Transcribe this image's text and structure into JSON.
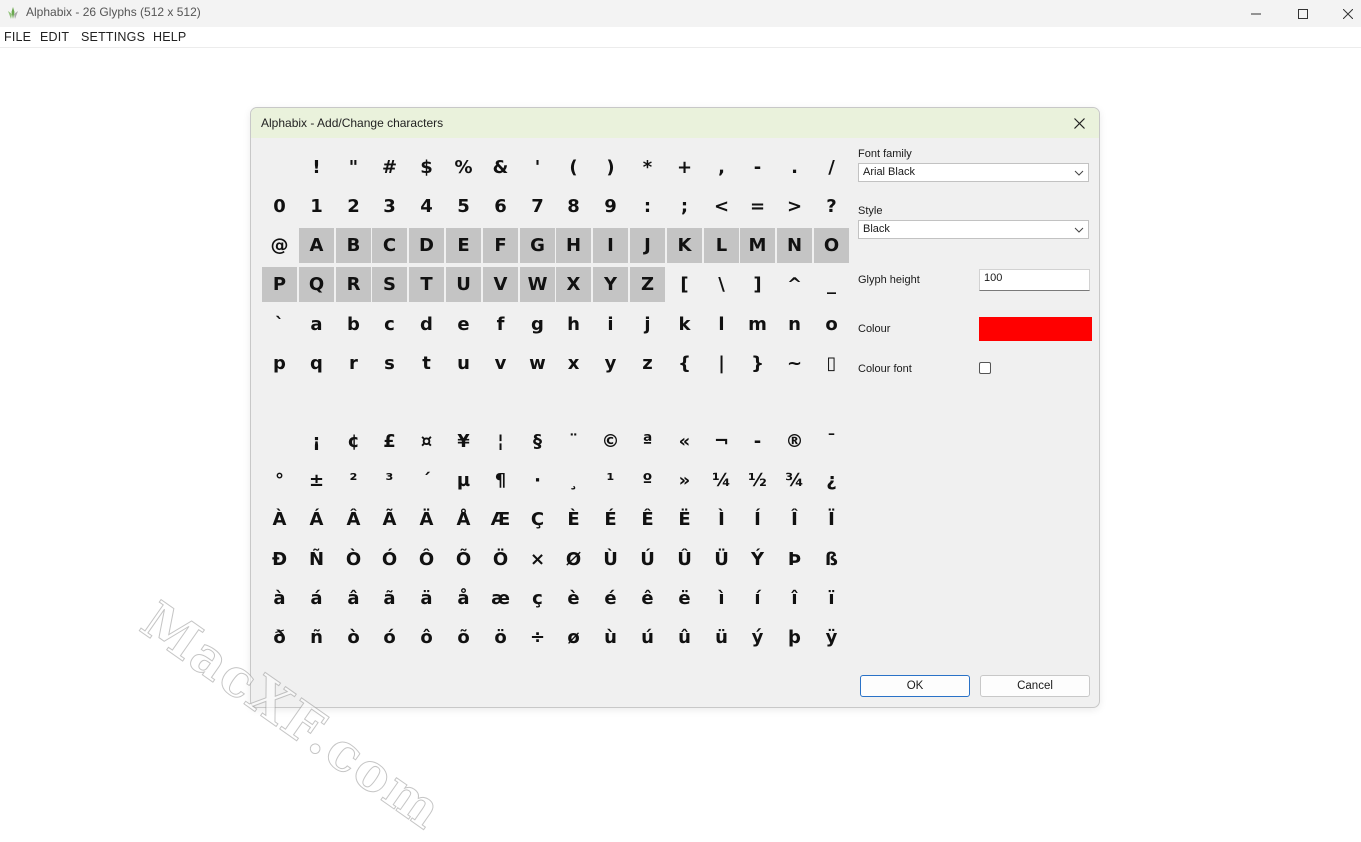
{
  "window": {
    "title": "Alphabix - 26 Glyphs (512 x 512)",
    "controls": [
      "minimize-icon",
      "maximize-icon",
      "close-icon"
    ]
  },
  "menu": [
    "FILE",
    "EDIT",
    "SETTINGS",
    "HELP"
  ],
  "dialog": {
    "title": "Alphabix - Add/Change characters",
    "glyph_rows": [
      [
        " ",
        "!",
        "\"",
        "#",
        "$",
        "%",
        "&",
        "'",
        "(",
        ")",
        "*",
        "+",
        ",",
        "-",
        ".",
        "/"
      ],
      [
        "0",
        "1",
        "2",
        "3",
        "4",
        "5",
        "6",
        "7",
        "8",
        "9",
        ":",
        ";",
        "<",
        "=",
        ">",
        "?"
      ],
      [
        "@",
        "A",
        "B",
        "C",
        "D",
        "E",
        "F",
        "G",
        "H",
        "I",
        "J",
        "K",
        "L",
        "M",
        "N",
        "O"
      ],
      [
        "P",
        "Q",
        "R",
        "S",
        "T",
        "U",
        "V",
        "W",
        "X",
        "Y",
        "Z",
        "[",
        "\\",
        "]",
        "^",
        "_"
      ],
      [
        "`",
        "a",
        "b",
        "c",
        "d",
        "e",
        "f",
        "g",
        "h",
        "i",
        "j",
        "k",
        "l",
        "m",
        "n",
        "o"
      ],
      [
        "p",
        "q",
        "r",
        "s",
        "t",
        "u",
        "v",
        "w",
        "x",
        "y",
        "z",
        "{",
        "|",
        "}",
        "~",
        "▯"
      ],
      [],
      [
        " ",
        "¡",
        "¢",
        "£",
        "¤",
        "¥",
        "¦",
        "§",
        "¨",
        "©",
        "ª",
        "«",
        "¬",
        "-",
        "®",
        "¯"
      ],
      [
        "°",
        "±",
        "²",
        "³",
        "´",
        "µ",
        "¶",
        "·",
        "¸",
        "¹",
        "º",
        "»",
        "¼",
        "½",
        "¾",
        "¿"
      ],
      [
        "À",
        "Á",
        "Â",
        "Ã",
        "Ä",
        "Å",
        "Æ",
        "Ç",
        "È",
        "É",
        "Ê",
        "Ë",
        "Ì",
        "Í",
        "Î",
        "Ï"
      ],
      [
        "Ð",
        "Ñ",
        "Ò",
        "Ó",
        "Ô",
        "Õ",
        "Ö",
        "×",
        "Ø",
        "Ù",
        "Ú",
        "Û",
        "Ü",
        "Ý",
        "Þ",
        "ß"
      ],
      [
        "à",
        "á",
        "â",
        "ã",
        "ä",
        "å",
        "æ",
        "ç",
        "è",
        "é",
        "ê",
        "ë",
        "ì",
        "í",
        "î",
        "ï"
      ],
      [
        "ð",
        "ñ",
        "ò",
        "ó",
        "ô",
        "õ",
        "ö",
        "÷",
        "ø",
        "ù",
        "ú",
        "û",
        "ü",
        "ý",
        "þ",
        "ÿ"
      ]
    ],
    "selected_glyphs": [
      "A",
      "B",
      "C",
      "D",
      "E",
      "F",
      "G",
      "H",
      "I",
      "J",
      "K",
      "L",
      "M",
      "N",
      "O",
      "P",
      "Q",
      "R",
      "S",
      "T",
      "U",
      "V",
      "W",
      "X",
      "Y",
      "Z"
    ],
    "font_family_label": "Font family",
    "font_family_value": "Arial Black",
    "style_label": "Style",
    "style_value": "Black",
    "glyph_height_label": "Glyph height",
    "glyph_height_value": "100",
    "colour_label": "Colour",
    "colour_value": "#ff0000",
    "colour_font_label": "Colour font",
    "colour_font_checked": false,
    "ok_label": "OK",
    "cancel_label": "Cancel"
  },
  "watermark": "MacXF.com",
  "colors": {
    "dialog_title_bg": "#eaf2dc",
    "selected_cell_bg": "#c4c4c4",
    "dialog_bg": "#f0f0f0"
  }
}
